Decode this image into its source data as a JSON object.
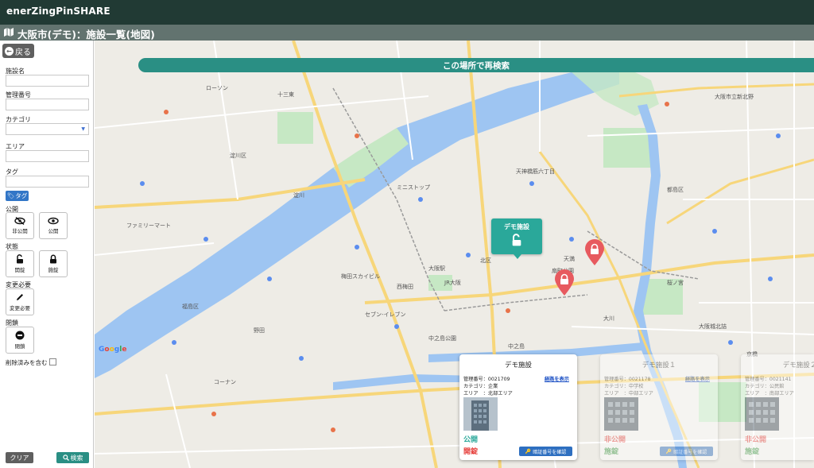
{
  "header": {
    "brand": "enerZingPinSHARE",
    "page_title": "大阪市(デモ)：施設一覧(地図)"
  },
  "sidebar": {
    "back_label": "戻る",
    "filters": {
      "facility_name": "施設名",
      "management_no": "管理番号",
      "category": "カテゴリ",
      "area": "エリア",
      "tag": "タグ",
      "tag_button": "タグ"
    },
    "public_section": {
      "label": "公開",
      "private_btn": "非公開",
      "public_btn": "公開"
    },
    "lock_section": {
      "label": "状態",
      "open_btn": "開錠",
      "closed_btn": "施錠"
    },
    "change_section": {
      "label": "変更必要",
      "btn": "変更必要"
    },
    "closure_section": {
      "label": "閉鎖",
      "btn": "閉鎖"
    },
    "include_deleted": "削除済みを含む",
    "clear_label": "クリア",
    "search_label": "検索"
  },
  "map": {
    "research_label": "この場所で再検索",
    "demo_marker_label": "デモ施設",
    "google_letters": [
      "G",
      "o",
      "o",
      "g",
      "l",
      "e"
    ],
    "place_labels": [
      "十三東",
      "淀川区",
      "大阪市立新北野",
      "都島区",
      "北区",
      "中之島",
      "梅田スカイビル",
      "大阪駅",
      "扇町公園",
      "天満",
      "大阪城北詰",
      "ファミリーマート",
      "セブン-イレブン",
      "ローソン",
      "福島区",
      "野田",
      "天神橋筋六丁目",
      "大川",
      "桜ノ宮",
      "京橋",
      "淀川",
      "ミニストップ",
      "コーナン",
      "中之島公園",
      "西梅田",
      "JR大阪"
    ],
    "colors": {
      "water": "#9ec5f2",
      "park": "#c6e8c4",
      "road_major": "#f7d67a",
      "pin": "#e75a5f",
      "accent": "#2aa89a"
    }
  },
  "cards": [
    {
      "title": "デモ施設",
      "management_no": "管理番号：0021709",
      "category": "カテゴリ：企業",
      "area": "エリア　：北部エリア",
      "route_link": "経路を表示",
      "status_public": "公開",
      "status_lock": "開錠",
      "confirm_btn": "暗証番号を確認"
    },
    {
      "title": "デモ施設１",
      "management_no": "管理番号：0021178",
      "category": "カテゴリ：中学校",
      "area": "エリア　：中部エリア",
      "route_link": "経路を表示",
      "status_public": "非公開",
      "status_lock": "施錠",
      "confirm_btn": "暗証番号を確認"
    },
    {
      "title": "デモ施設２",
      "management_no": "管理番号：0021141",
      "category": "カテゴリ：公民館",
      "area": "エリア　：南部エリア",
      "status_public": "非公開",
      "status_lock": "施錠"
    }
  ]
}
